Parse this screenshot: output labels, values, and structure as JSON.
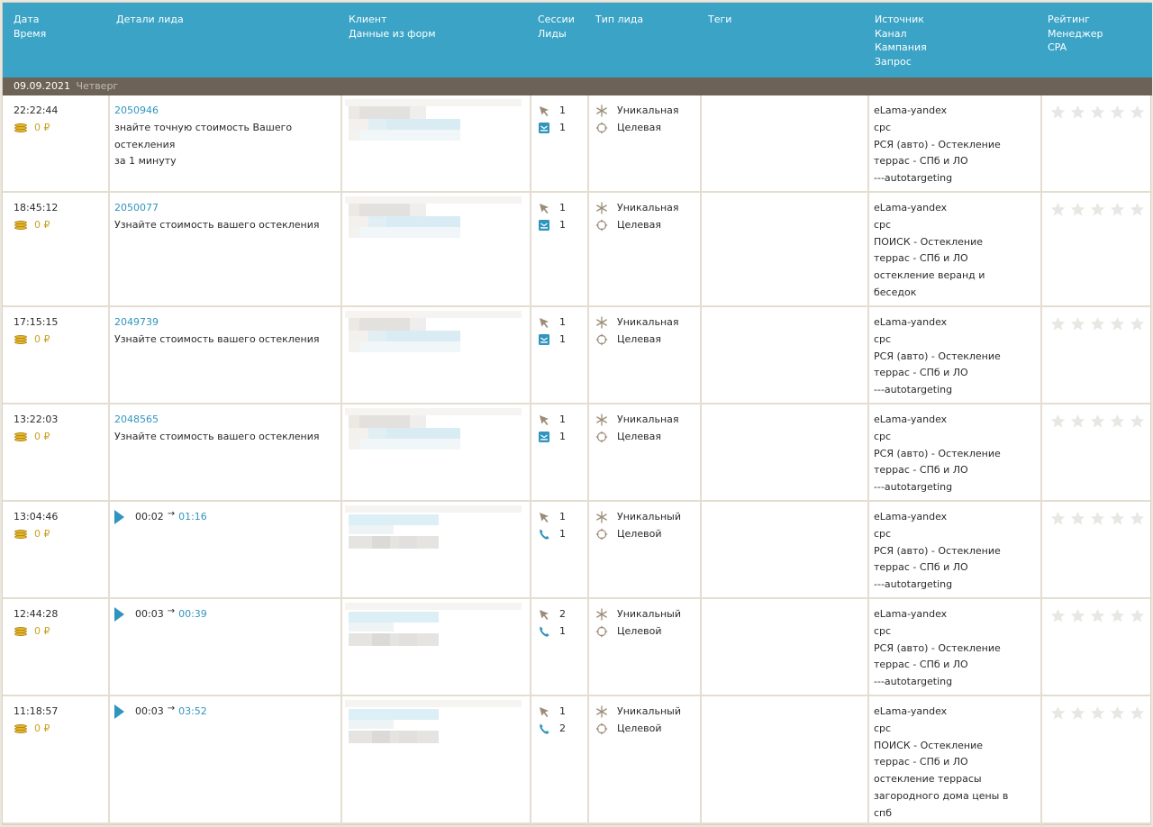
{
  "header": {
    "col_date": [
      "Дата",
      "Время"
    ],
    "col_details": [
      "Детали лида"
    ],
    "col_client": [
      "Клиент",
      "Данные из форм"
    ],
    "col_sessions": [
      "Сессии",
      "Лиды"
    ],
    "col_leadtype": [
      "Тип лида"
    ],
    "col_tags": [
      "Теги"
    ],
    "col_source": [
      "Источник",
      "Канал",
      "Кампания",
      "Запрос"
    ],
    "col_rating": [
      "Рейтинг",
      "Менеджер",
      "CPA"
    ]
  },
  "date_band": {
    "date": "09.09.2021",
    "weekday": "Четверг"
  },
  "colors": {
    "header_bg": "#3aa3c6",
    "band_bg": "#6c6256",
    "link": "#2f95bf",
    "coins": "#c9a227",
    "icon_brown": "#9b8c78",
    "icon_blue": "#2f95bf",
    "star": "#e9e7e3"
  },
  "rows": [
    {
      "time": "22:22:44",
      "price": "0 ₽",
      "kind": "form",
      "lead_id": "2050946",
      "desc_lines": [
        "знайте точную стоимость Вашего остекления",
        "за 1 минуту"
      ],
      "sessions": "1",
      "leads": "1",
      "lead_icon": "form-icon",
      "type_unique": "Уникальная",
      "type_target": "Целевая",
      "source": [
        "eLama-yandex",
        "cpc",
        "РСЯ (авто) - Остекление",
        "террас - СПб и ЛО",
        "---autotargeting"
      ],
      "rating_stars": 5
    },
    {
      "time": "18:45:12",
      "price": "0 ₽",
      "kind": "form",
      "lead_id": "2050077",
      "desc_lines": [
        "Узнайте стоимость вашего остекления"
      ],
      "sessions": "1",
      "leads": "1",
      "lead_icon": "form-icon",
      "type_unique": "Уникальная",
      "type_target": "Целевая",
      "source": [
        "eLama-yandex",
        "cpc",
        "ПОИСК - Остекление",
        "террас - СПб и ЛО",
        "остекление веранд и",
        "беседок"
      ],
      "rating_stars": 5
    },
    {
      "time": "17:15:15",
      "price": "0 ₽",
      "kind": "form",
      "lead_id": "2049739",
      "desc_lines": [
        "Узнайте стоимость вашего остекления"
      ],
      "sessions": "1",
      "leads": "1",
      "lead_icon": "form-icon",
      "type_unique": "Уникальная",
      "type_target": "Целевая",
      "source": [
        "eLama-yandex",
        "cpc",
        "РСЯ (авто) - Остекление",
        "террас - СПб и ЛО",
        "---autotargeting"
      ],
      "rating_stars": 5
    },
    {
      "time": "13:22:03",
      "price": "0 ₽",
      "kind": "form",
      "lead_id": "2048565",
      "desc_lines": [
        "Узнайте стоимость вашего остекления"
      ],
      "sessions": "1",
      "leads": "1",
      "lead_icon": "form-icon",
      "type_unique": "Уникальная",
      "type_target": "Целевая",
      "source": [
        "eLama-yandex",
        "cpc",
        "РСЯ (авто) - Остекление",
        "террас - СПб и ЛО",
        "---autotargeting"
      ],
      "rating_stars": 5
    },
    {
      "time": "13:04:46",
      "price": "0 ₽",
      "kind": "call",
      "call_wait": "00:02",
      "call_duration": "01:16",
      "sessions": "1",
      "leads": "1",
      "lead_icon": "phone-icon",
      "type_unique": "Уникальный",
      "type_target": "Целевой",
      "source": [
        "eLama-yandex",
        "cpc",
        "РСЯ (авто) - Остекление",
        "террас - СПб и ЛО",
        "---autotargeting"
      ],
      "rating_stars": 5
    },
    {
      "time": "12:44:28",
      "price": "0 ₽",
      "kind": "call",
      "call_wait": "00:03",
      "call_duration": "00:39",
      "sessions": "2",
      "leads": "1",
      "lead_icon": "phone-icon",
      "type_unique": "Уникальный",
      "type_target": "Целевой",
      "source": [
        "eLama-yandex",
        "cpc",
        "РСЯ (авто) - Остекление",
        "террас - СПб и ЛО",
        "---autotargeting"
      ],
      "rating_stars": 5
    },
    {
      "time": "11:18:57",
      "price": "0 ₽",
      "kind": "call",
      "call_wait": "00:03",
      "call_duration": "03:52",
      "sessions": "1",
      "leads": "2",
      "lead_icon": "phone-icon",
      "type_unique": "Уникальный",
      "type_target": "Целевой",
      "source": [
        "eLama-yandex",
        "cpc",
        "ПОИСК - Остекление",
        "террас - СПб и ЛО",
        "остекление террасы",
        "загородного дома цены в",
        "спб"
      ],
      "rating_stars": 5
    }
  ]
}
